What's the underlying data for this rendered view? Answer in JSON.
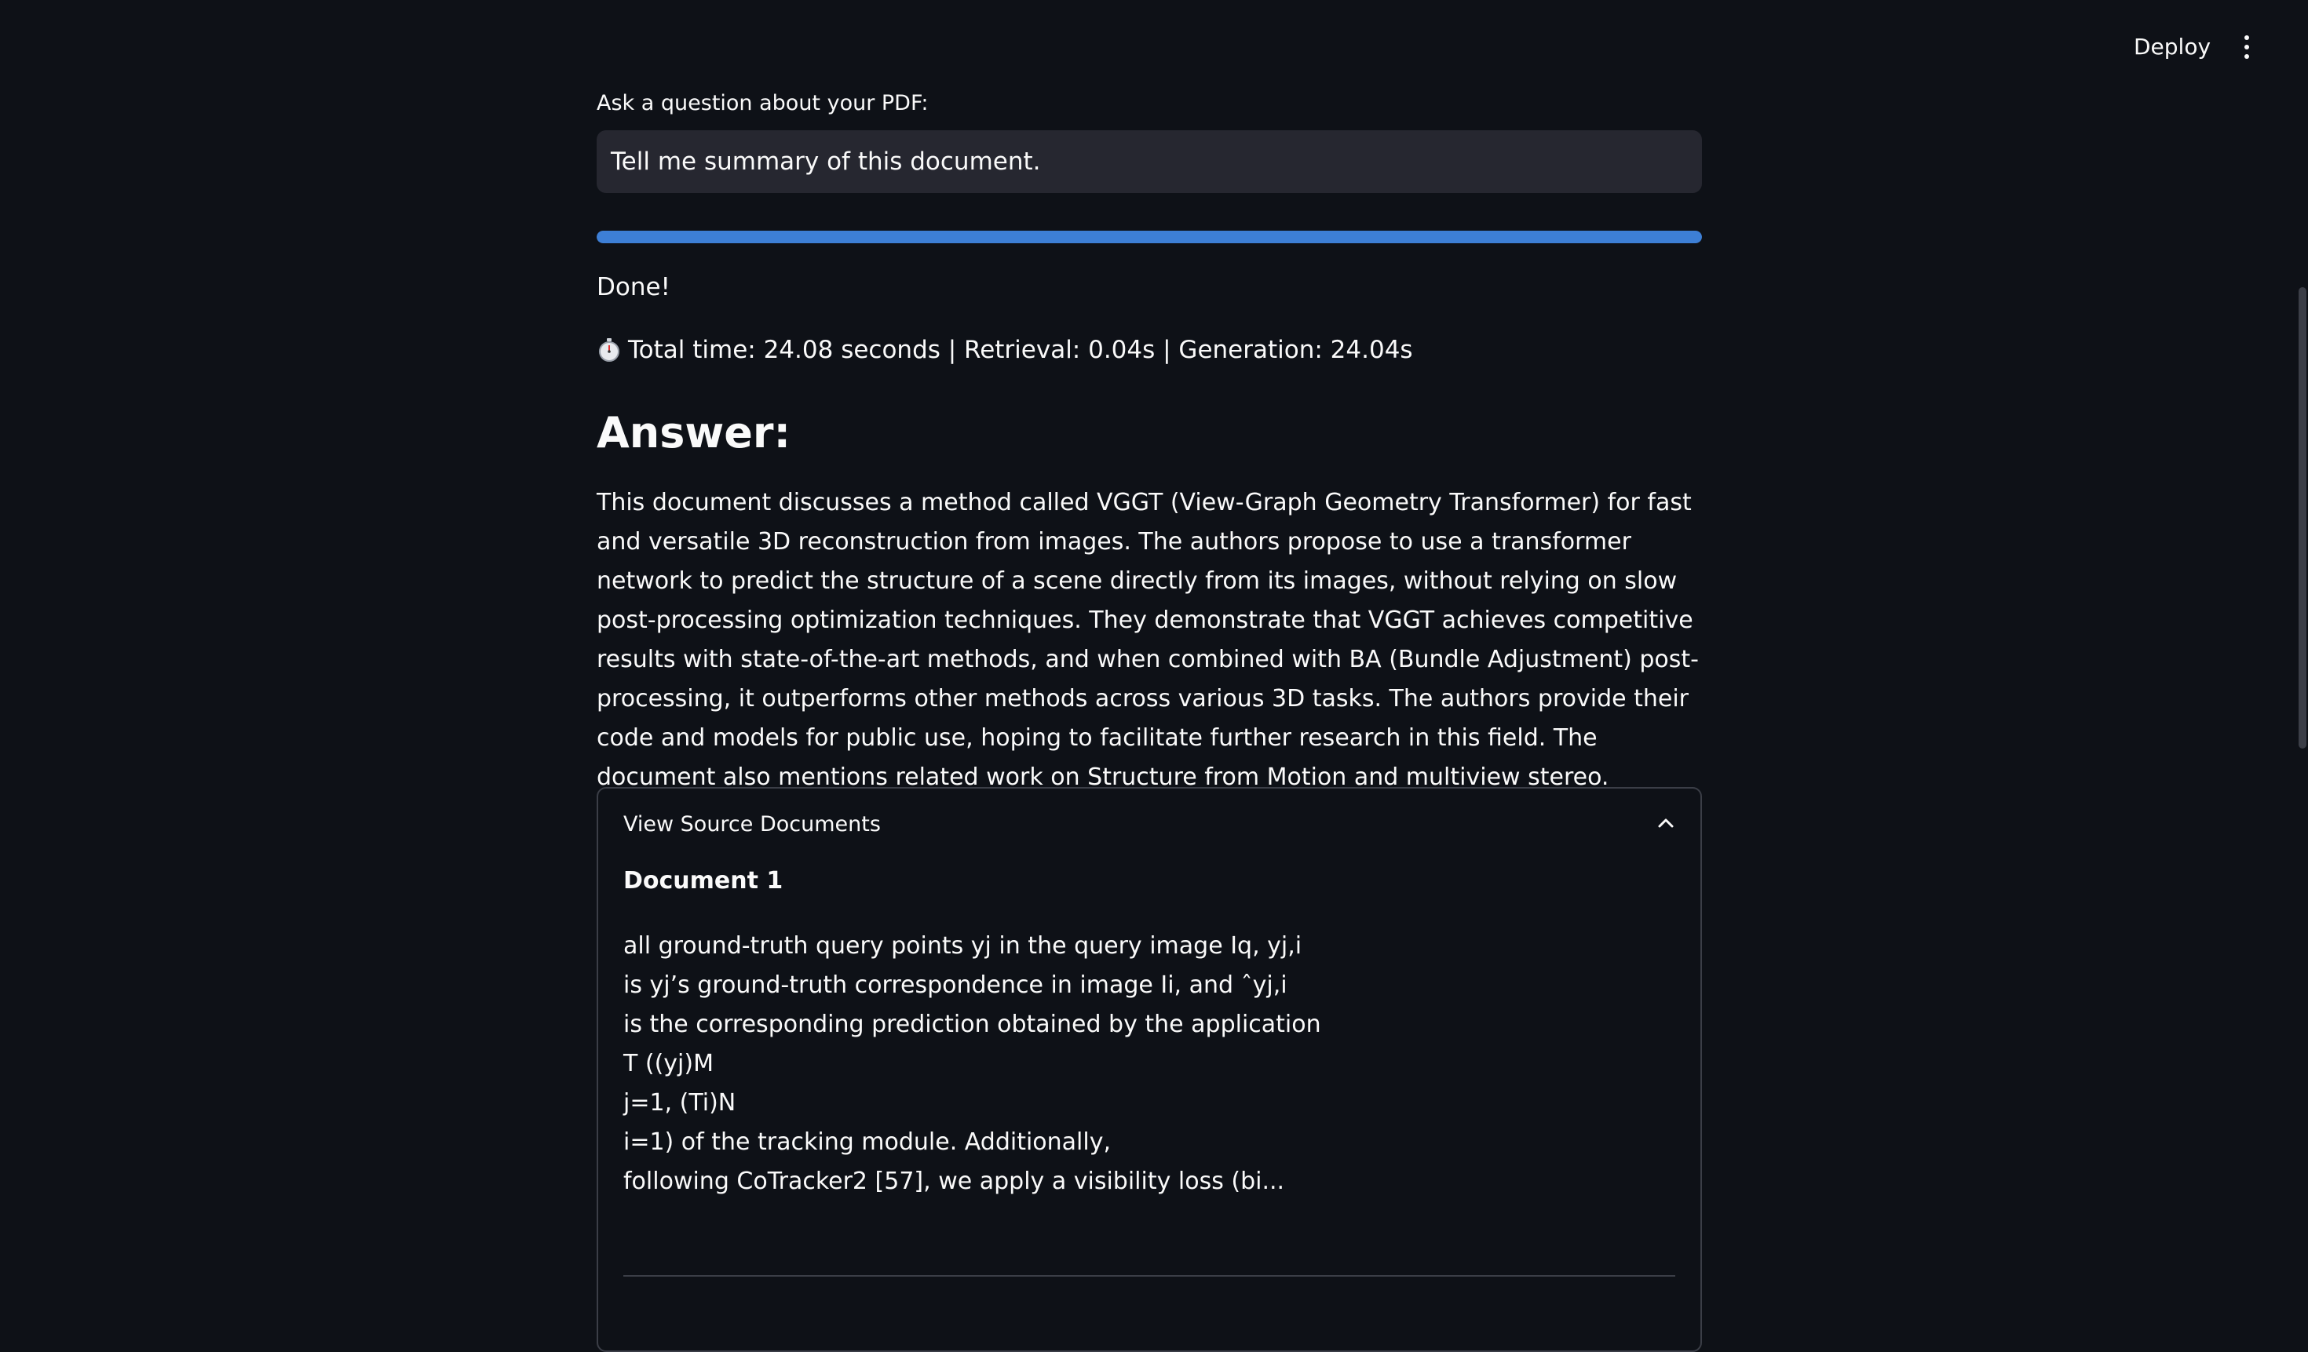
{
  "header": {
    "deploy_label": "Deploy",
    "menu_icon": "kebab-menu-icon"
  },
  "query": {
    "label": "Ask a question about your PDF:",
    "value": "Tell me summary of this document."
  },
  "progress": {
    "percent": 100,
    "color": "#3d7fd6"
  },
  "status": {
    "text": "Done!",
    "timing_icon": "stopwatch-icon",
    "timing": "Total time: 24.08 seconds | Retrieval: 0.04s | Generation: 24.04s"
  },
  "answer": {
    "title": "Answer:",
    "body": "This document discusses a method called VGGT (View-Graph Geometry Transformer) for fast and versatile 3D reconstruction from images. The authors propose to use a transformer network to predict the structure of a scene directly from its images, without relying on slow post-processing optimization techniques. They demonstrate that VGGT achieves competitive results with state-of-the-art methods, and when combined with BA (Bundle Adjustment) post-processing, it outperforms other methods across various 3D tasks. The authors provide their code and models for public use, hoping to facilitate further research in this field. The document also mentions related work on Structure from Motion and multiview stereo."
  },
  "sources": {
    "title": "View Source Documents",
    "expanded": true,
    "documents": [
      {
        "title": "Document 1",
        "lines": [
          "all ground-truth query points yj in the query image Iq, yj,i",
          "is yj’s ground-truth correspondence in image Ii, and ˆyj,i",
          "is the corresponding prediction obtained by the application",
          "T ((yj)M",
          "j=1, (Ti)N",
          "i=1) of the tracking module. Additionally,",
          "following CoTracker2 [57], we apply a visibility loss (bi..."
        ]
      }
    ]
  }
}
